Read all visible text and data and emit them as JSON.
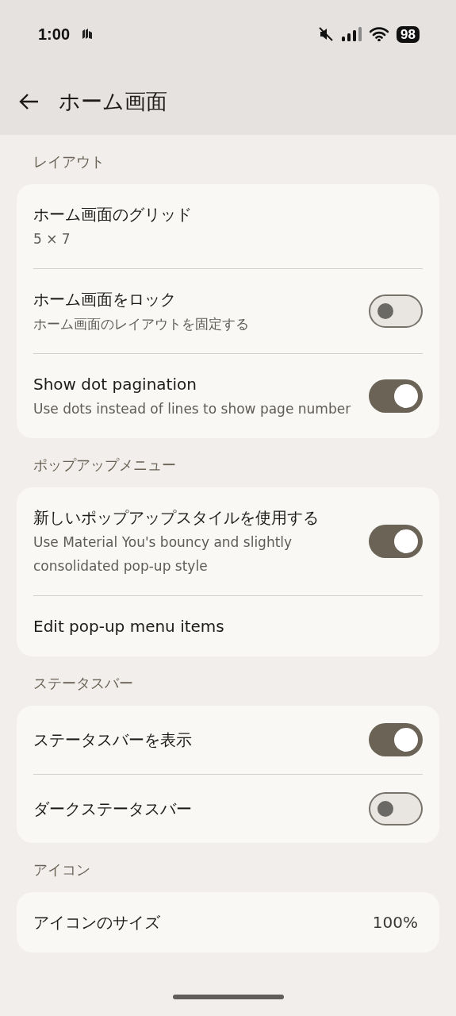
{
  "status_bar": {
    "time": "1:00",
    "battery": "98"
  },
  "header": {
    "title": "ホーム画面"
  },
  "sections": [
    {
      "title": "レイアウト",
      "items": [
        {
          "kind": "text",
          "title": "ホーム画面のグリッド",
          "subtitle": "5 × 7"
        },
        {
          "kind": "toggle",
          "title": "ホーム画面をロック",
          "subtitle": "ホーム画面のレイアウトを固定する",
          "on": false
        },
        {
          "kind": "toggle",
          "title": "Show dot pagination",
          "subtitle": "Use dots instead of lines to show page number",
          "on": true
        }
      ]
    },
    {
      "title": "ポップアップメニュー",
      "items": [
        {
          "kind": "toggle",
          "title": "新しいポップアップスタイルを使用する",
          "subtitle": "Use Material You's bouncy and slightly consolidated pop-up style",
          "on": true
        },
        {
          "kind": "text",
          "title": "Edit pop-up menu items"
        }
      ]
    },
    {
      "title": "ステータスバー",
      "items": [
        {
          "kind": "toggle",
          "title": "ステータスバーを表示",
          "on": true
        },
        {
          "kind": "toggle",
          "title": "ダークステータスバー",
          "on": false
        }
      ]
    },
    {
      "title": "アイコン",
      "items": [
        {
          "kind": "value",
          "title": "アイコンのサイズ",
          "value": "100%"
        }
      ]
    }
  ]
}
